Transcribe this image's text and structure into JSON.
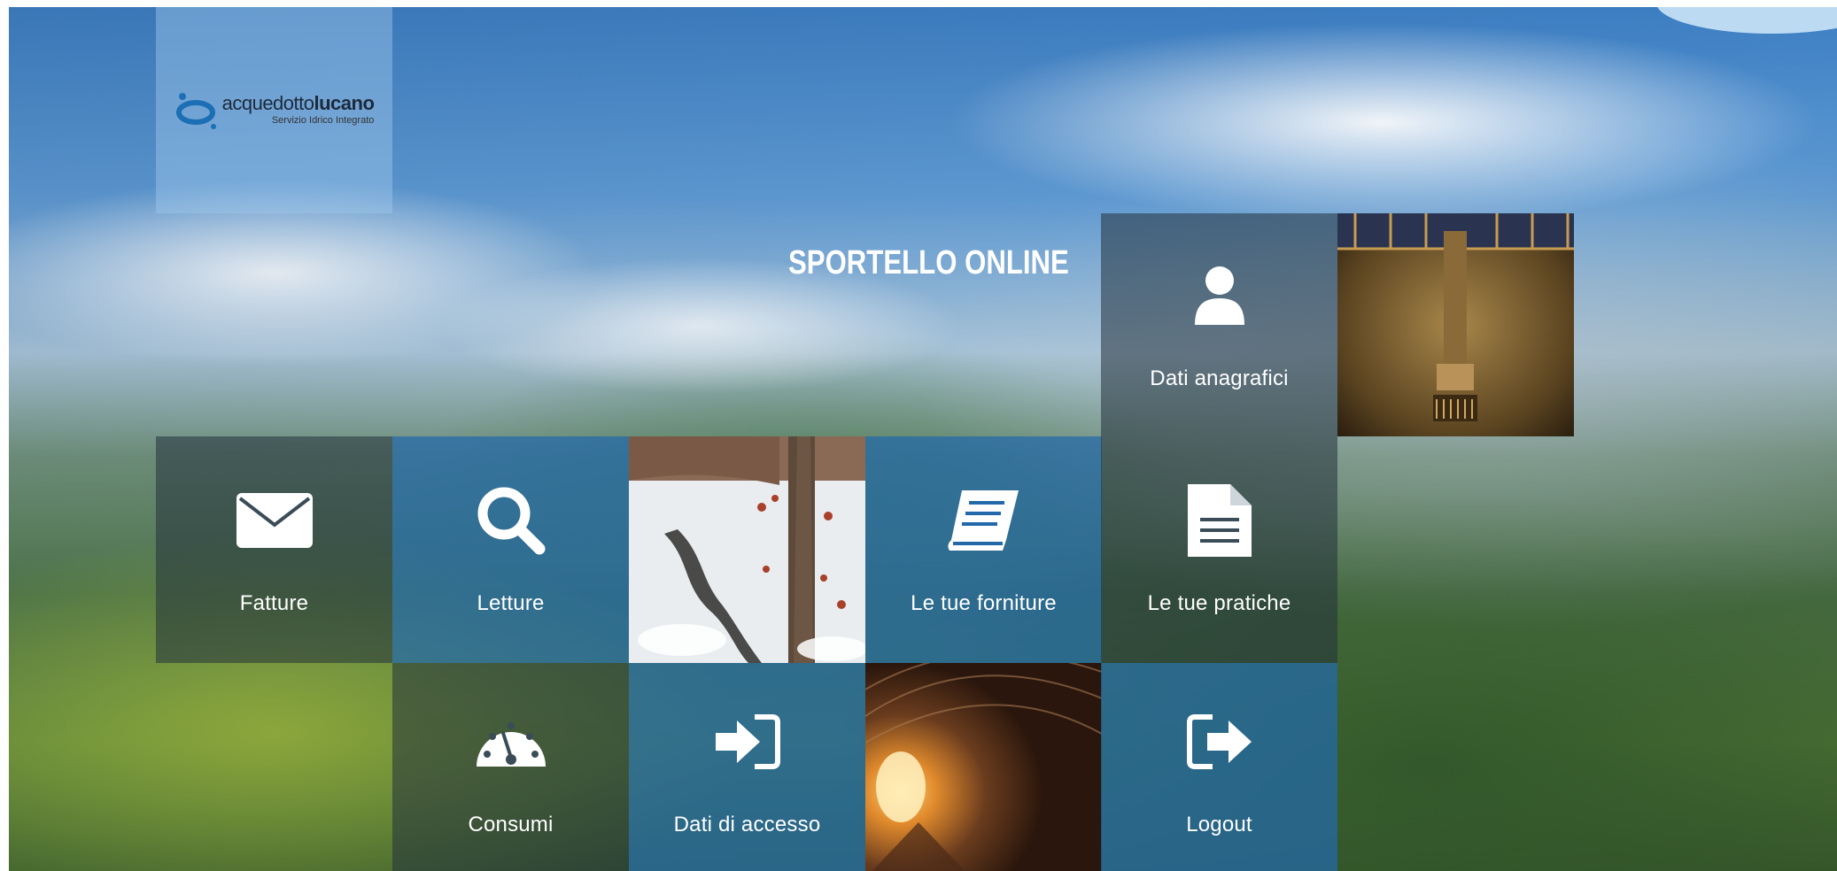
{
  "brand": {
    "name": "acquedottolucano",
    "name_part1": "acquedotto",
    "name_part2": "lucano",
    "tagline": "Servizio Idrico Integrato"
  },
  "page_title": "SPORTELLO ONLINE",
  "tiles": {
    "dati_anagrafici": {
      "label": "Dati anagrafici",
      "icon": "user-icon"
    },
    "fatture": {
      "label": "Fatture",
      "icon": "envelope-icon"
    },
    "letture": {
      "label": "Letture",
      "icon": "search-icon"
    },
    "le_tue_forniture": {
      "label": "Le tue forniture",
      "icon": "book-icon"
    },
    "le_tue_pratiche": {
      "label": "Le tue pratiche",
      "icon": "document-icon"
    },
    "consumi": {
      "label": "Consumi",
      "icon": "gauge-icon"
    },
    "dati_di_accesso": {
      "label": "Dati di accesso",
      "icon": "sign-in-icon"
    },
    "logout": {
      "label": "Logout",
      "icon": "sign-out-icon"
    }
  },
  "photos": [
    "fountain-photo",
    "snowy-stream-photo",
    "tunnel-photo"
  ],
  "colors": {
    "tile_blue": "#2369aa",
    "tile_dark": "#23323c",
    "text": "#ffffff"
  }
}
